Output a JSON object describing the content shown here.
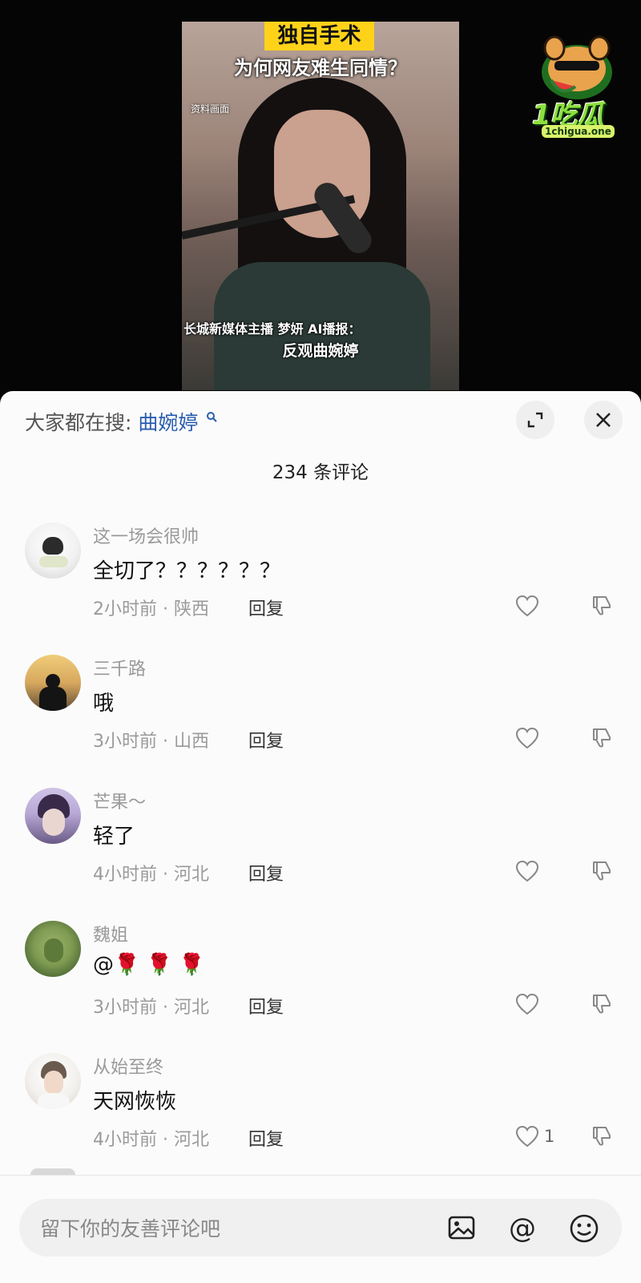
{
  "video": {
    "title_highlight": "独自手术",
    "title_line2": "为何网友难生同情？",
    "tag": "资料画面",
    "caption1": "长城新媒体主播 梦妍 AI播报：",
    "caption2": "反观曲婉婷"
  },
  "logo": {
    "wordmark": "1吃瓜",
    "domain": "1chigua.one"
  },
  "sheet": {
    "search_label": "大家都在搜:",
    "search_term": "曲婉婷",
    "comment_count_label": "234 条评论",
    "icons": {
      "expand": "expand-icon",
      "close": "close-icon"
    }
  },
  "comments": [
    {
      "user": "这一场会很帅",
      "text": "全切了？？？？？？",
      "meta": "2小时前 · 陕西",
      "reply": "回复",
      "likes": "",
      "avatar_colors": [
        "#ffffff",
        "#2b2b2b"
      ]
    },
    {
      "user": "三千路",
      "text": "哦",
      "meta": "3小时前 · 山西",
      "reply": "回复",
      "likes": "",
      "avatar_colors": [
        "#d7a85e",
        "#1a1a1a"
      ]
    },
    {
      "user": "芒果～",
      "text": "轻了",
      "meta": "4小时前 · 河北",
      "reply": "回复",
      "likes": "",
      "avatar_colors": [
        "#b9a9d6",
        "#3a2a4a"
      ]
    },
    {
      "user": "魏姐",
      "text": "@🌹 🌹 🌹",
      "meta": "3小时前 · 河北",
      "reply": "回复",
      "likes": "",
      "avatar_colors": [
        "#7f9b52",
        "#2f4a22"
      ]
    },
    {
      "user": "从始至终",
      "text": "天网恢恢",
      "meta": "4小时前 · 河北",
      "reply": "回复",
      "likes": "1",
      "avatar_colors": [
        "#f3f1ee",
        "#6b5a4e"
      ]
    }
  ],
  "composer": {
    "placeholder": "留下你的友善评论吧",
    "icons": [
      "image-icon",
      "at-icon",
      "emoji-icon"
    ]
  }
}
